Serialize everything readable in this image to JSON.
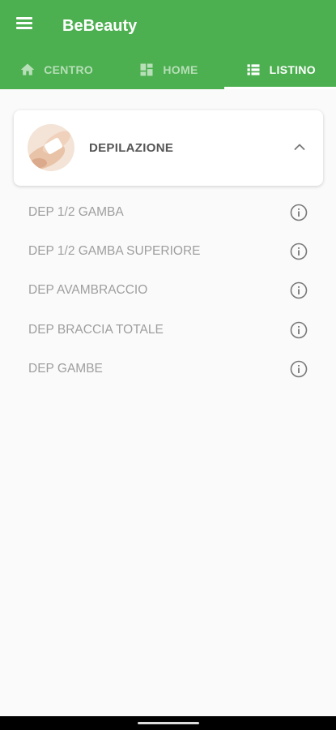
{
  "app": {
    "title": "BeBeauty",
    "colors": {
      "primary": "#4caf50",
      "tab_inactive": "#b7dfb8",
      "text_muted": "#9e9e9e"
    }
  },
  "header": {
    "menu_icon": "hamburger-menu-icon"
  },
  "tabs": [
    {
      "label": "CENTRO",
      "icon": "home-icon",
      "active": false
    },
    {
      "label": "HOME",
      "icon": "dashboard-icon",
      "active": false
    },
    {
      "label": "LISTINO",
      "icon": "list-icon",
      "active": true
    }
  ],
  "category": {
    "title": "DEPILAZIONE",
    "image": "depilation-photo",
    "expanded": true,
    "toggle_icon": "chevron-up-icon"
  },
  "items": [
    {
      "label": "DEP 1/2 GAMBA",
      "icon": "info-icon"
    },
    {
      "label": "DEP 1/2 GAMBA SUPERIORE",
      "icon": "info-icon"
    },
    {
      "label": "DEP AVAMBRACCIO",
      "icon": "info-icon"
    },
    {
      "label": "DEP BRACCIA TOTALE",
      "icon": "info-icon"
    },
    {
      "label": "DEP GAMBE",
      "icon": "info-icon"
    }
  ]
}
